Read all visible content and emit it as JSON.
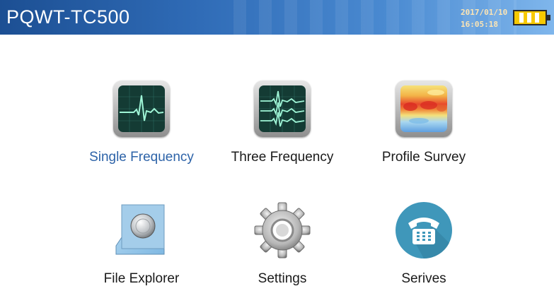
{
  "header": {
    "app_title": "PQWT-TC500",
    "date": "2017/01/10",
    "time": "16:05:18"
  },
  "battery": {
    "icon": "battery-icon",
    "level": "full"
  },
  "menu": {
    "selected": "single-frequency",
    "items": [
      {
        "id": "single-frequency",
        "label": "Single Frequency",
        "icon": "single-waveform-monitor-icon"
      },
      {
        "id": "three-frequency",
        "label": "Three Frequency",
        "icon": "triple-waveform-monitor-icon"
      },
      {
        "id": "profile-survey",
        "label": "Profile Survey",
        "icon": "heatmap-profile-icon"
      },
      {
        "id": "file-explorer",
        "label": "File Explorer",
        "icon": "file-explorer-icon"
      },
      {
        "id": "settings",
        "label": "Settings",
        "icon": "gear-icon"
      },
      {
        "id": "serives",
        "label": "Serives",
        "icon": "telephone-icon"
      }
    ]
  },
  "colors": {
    "header_start": "#1c4f93",
    "header_end": "#7fb6ec",
    "selected_label": "#2d63a8",
    "clock_text": "#fde5b4",
    "battery_fill": "#f7c900"
  }
}
